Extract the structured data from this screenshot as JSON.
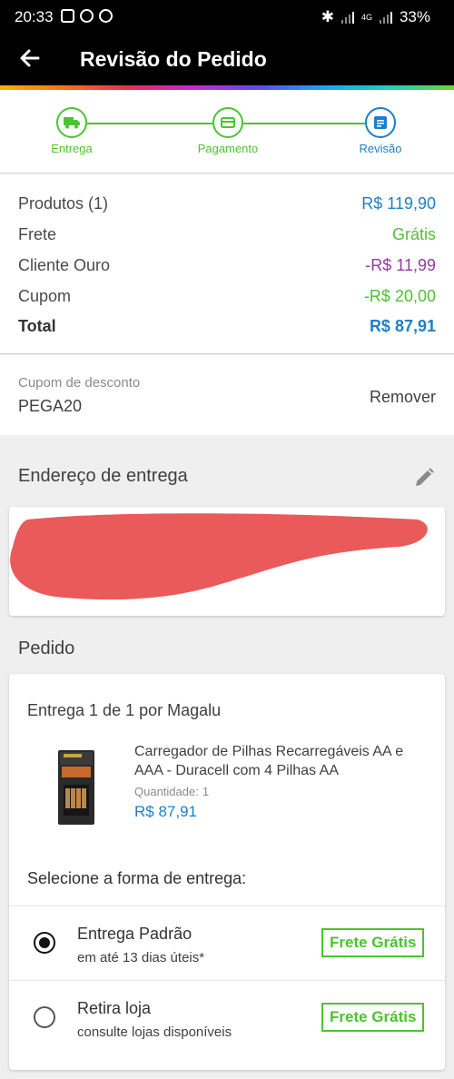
{
  "status_bar": {
    "time": "20:33",
    "network": "4G",
    "battery": "33%"
  },
  "app_bar": {
    "back_icon": "arrow-left-icon",
    "title": "Revisão do Pedido"
  },
  "stepper": {
    "steps": [
      {
        "label": "Entrega",
        "icon": "truck-icon",
        "state": "done"
      },
      {
        "label": "Pagamento",
        "icon": "card-icon",
        "state": "done"
      },
      {
        "label": "Revisão",
        "icon": "document-icon",
        "state": "active"
      }
    ]
  },
  "summary": {
    "rows": [
      {
        "label": "Produtos (1)",
        "value": "R$ 119,90",
        "color": "#1d7fc8"
      },
      {
        "label": "Frete",
        "value": "Grátis",
        "color": "#4cc42f"
      },
      {
        "label": "Cliente Ouro",
        "value": "-R$ 11,99",
        "color": "#8e3f9a"
      },
      {
        "label": "Cupom",
        "value": "-R$ 20,00",
        "color": "#4cc42f"
      },
      {
        "label": "Total",
        "value": "R$ 87,91",
        "color": "#1d7fc8"
      }
    ]
  },
  "coupon": {
    "label": "Cupom de desconto",
    "code": "PEGA20",
    "remove_label": "Remover"
  },
  "address": {
    "title": "Endereço de entrega",
    "edit_icon": "pencil-icon"
  },
  "order": {
    "title": "Pedido",
    "delivery_title": "Entrega 1 de 1 por Magalu",
    "product": {
      "name": "Carregador de Pilhas Recarregáveis AA e AAA - Duracell com 4 Pilhas AA",
      "quantity_label": "Quantidade:",
      "quantity": "1",
      "price": "R$ 87,91"
    },
    "choose_label": "Selecione a forma de entrega:",
    "options": [
      {
        "name": "Entrega Padrão",
        "sub": "em até 13 dias úteis*",
        "badge": "Frete Grátis",
        "selected": true
      },
      {
        "name": "Retira loja",
        "sub": "consulte lojas disponíveis",
        "badge": "Frete Grátis",
        "selected": false
      }
    ]
  },
  "colors": {
    "green": "#4cc42f",
    "blue": "#1d7fc8",
    "purple": "#8e3f9a",
    "redaction": "#ea5a5a"
  }
}
